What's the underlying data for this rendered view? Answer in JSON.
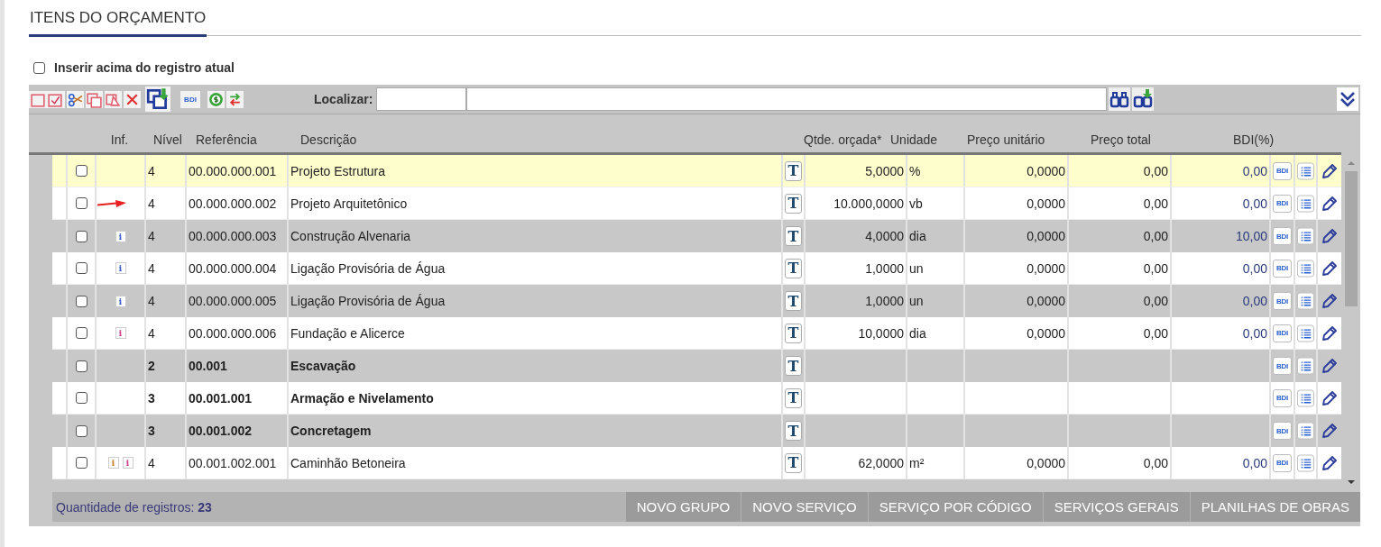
{
  "section": {
    "title": "ITENS DO ORÇAMENTO"
  },
  "insert_above": {
    "label": "Inserir acima do registro atual",
    "checked": false
  },
  "toolbar": {
    "bdi_label": "BDI",
    "search_label": "Localizar:"
  },
  "table": {
    "columns": [
      "Inf.",
      "Nível",
      "Referência",
      "Descrição",
      "Qtde. orçada*",
      "Unidade",
      "Preço unitário",
      "Preço total",
      "BDI(%)"
    ],
    "rows": [
      {
        "kind": "item",
        "selected": true,
        "checked": false,
        "info": [],
        "nivel": "4",
        "ref": "00.000.000.001",
        "desc": "Projeto Estrutura",
        "t_button": "T",
        "qty": "5,0000",
        "unit": "%",
        "unit_price": "0,0000",
        "total": "0,00",
        "bdi": "0,00",
        "bdi_button": "BDI"
      },
      {
        "kind": "item",
        "selected": false,
        "checked": false,
        "info": [
          {
            "kind": "arrow"
          }
        ],
        "nivel": "4",
        "ref": "00.000.000.002",
        "desc": "Projeto Arquitetônico",
        "t_button": "T",
        "qty": "10.000,0000",
        "unit": "vb",
        "unit_price": "0,0000",
        "total": "0,00",
        "bdi": "0,00",
        "bdi_button": "BDI"
      },
      {
        "kind": "item",
        "selected": false,
        "checked": false,
        "info": [
          {
            "kind": "info",
            "label": "i",
            "color": "#3a5fcd"
          }
        ],
        "nivel": "4",
        "ref": "00.000.000.003",
        "desc": "Construção Alvenaria",
        "t_button": "T",
        "qty": "4,0000",
        "unit": "dia",
        "unit_price": "0,0000",
        "total": "0,00",
        "bdi": "10,00",
        "bdi_button": "BDI"
      },
      {
        "kind": "item",
        "selected": false,
        "checked": false,
        "info": [
          {
            "kind": "info",
            "label": "i",
            "color": "#3a5fcd"
          }
        ],
        "nivel": "4",
        "ref": "00.000.000.004",
        "desc": "Ligação Provisória de Água",
        "t_button": "T",
        "qty": "1,0000",
        "unit": "un",
        "unit_price": "0,0000",
        "total": "0,00",
        "bdi": "0,00",
        "bdi_button": "BDI"
      },
      {
        "kind": "item",
        "selected": false,
        "checked": false,
        "info": [
          {
            "kind": "info",
            "label": "i",
            "color": "#3a5fcd"
          }
        ],
        "nivel": "4",
        "ref": "00.000.000.005",
        "desc": "Ligação Provisória de Água",
        "t_button": "T",
        "qty": "1,0000",
        "unit": "un",
        "unit_price": "0,0000",
        "total": "0,00",
        "bdi": "0,00",
        "bdi_button": "BDI"
      },
      {
        "kind": "item",
        "selected": false,
        "checked": false,
        "info": [
          {
            "kind": "info",
            "label": "i",
            "color": "#d0458a"
          }
        ],
        "nivel": "4",
        "ref": "00.000.000.006",
        "desc": "Fundação e Alicerce",
        "t_button": "T",
        "qty": "10,0000",
        "unit": "dia",
        "unit_price": "0,0000",
        "total": "0,00",
        "bdi": "0,00",
        "bdi_button": "BDI"
      },
      {
        "kind": "group",
        "selected": false,
        "checked": false,
        "info": [],
        "nivel": "2",
        "ref": "00.001",
        "desc": "Escavação",
        "t_button": "T",
        "bdi_button": "BDI"
      },
      {
        "kind": "group",
        "selected": false,
        "checked": false,
        "info": [],
        "nivel": "3",
        "ref": "00.001.001",
        "desc": "Armação e Nivelamento",
        "t_button": "T",
        "bdi_button": "BDI"
      },
      {
        "kind": "group",
        "selected": false,
        "checked": false,
        "info": [],
        "nivel": "3",
        "ref": "00.001.002",
        "desc": "Concretagem",
        "t_button": "T",
        "bdi_button": "BDI"
      },
      {
        "kind": "item",
        "selected": false,
        "checked": false,
        "info": [
          {
            "kind": "info",
            "label": "i",
            "color": "#c8822a"
          },
          {
            "kind": "info",
            "label": "i",
            "color": "#d0458a"
          }
        ],
        "nivel": "4",
        "ref": "00.001.002.001",
        "desc": "Caminhão Betoneira",
        "t_button": "T",
        "qty": "62,0000",
        "unit": "m²",
        "unit_price": "0,0000",
        "total": "0,00",
        "bdi": "0,00",
        "bdi_button": "BDI"
      }
    ]
  },
  "footer": {
    "count_label": "Quantidade de registros:",
    "count": "23",
    "buttons": [
      "NOVO GRUPO",
      "NOVO SERVIÇO",
      "SERVIÇO POR CÓDIGO",
      "SERVIÇOS GERAIS",
      "PLANILHAS DE OBRAS"
    ]
  }
}
